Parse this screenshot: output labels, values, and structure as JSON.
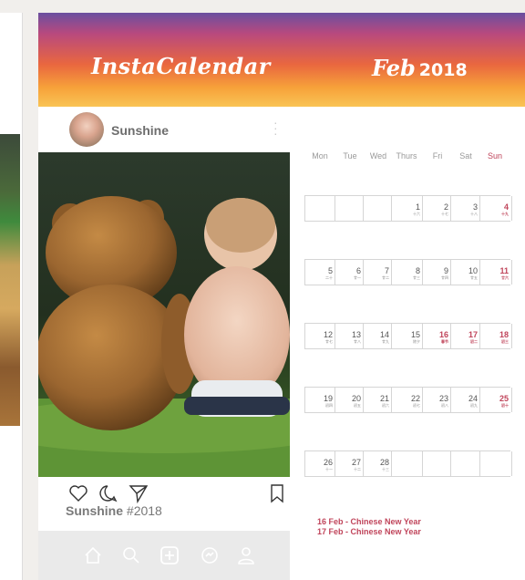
{
  "app_title": "InstaCalendar",
  "month": "Feb",
  "year": "2018",
  "post": {
    "username": "Sunshine",
    "caption_user": "Sunshine",
    "caption_tag": "#2018"
  },
  "icons": [
    "heart-icon",
    "comment-icon",
    "send-icon",
    "bookmark-icon",
    "home-icon",
    "search-icon",
    "add-icon",
    "activity-icon",
    "profile-icon",
    "more-icon"
  ],
  "calendar": {
    "weekdays": [
      "Mon",
      "Tue",
      "Wed",
      "Thurs",
      "Fri",
      "Sat",
      "Sun"
    ],
    "weeks": [
      [
        null,
        null,
        null,
        {
          "d": "1",
          "l": "十六"
        },
        {
          "d": "2",
          "l": "十七"
        },
        {
          "d": "3",
          "l": "十八"
        },
        {
          "d": "4",
          "l": "十九"
        }
      ],
      [
        {
          "d": "5",
          "l": "二十"
        },
        {
          "d": "6",
          "l": "廿一"
        },
        {
          "d": "7",
          "l": "廿二"
        },
        {
          "d": "8",
          "l": "廿三"
        },
        {
          "d": "9",
          "l": "廿四"
        },
        {
          "d": "10",
          "l": "廿五"
        },
        {
          "d": "11",
          "l": "廿六"
        }
      ],
      [
        {
          "d": "12",
          "l": "廿七"
        },
        {
          "d": "13",
          "l": "廿八"
        },
        {
          "d": "14",
          "l": "廿九"
        },
        {
          "d": "15",
          "l": "除夕"
        },
        {
          "d": "16",
          "l": "春节",
          "red": true
        },
        {
          "d": "17",
          "l": "初二",
          "red": true
        },
        {
          "d": "18",
          "l": "初三"
        }
      ],
      [
        {
          "d": "19",
          "l": "初四"
        },
        {
          "d": "20",
          "l": "初五"
        },
        {
          "d": "21",
          "l": "初六"
        },
        {
          "d": "22",
          "l": "初七"
        },
        {
          "d": "23",
          "l": "初八"
        },
        {
          "d": "24",
          "l": "初九"
        },
        {
          "d": "25",
          "l": "初十"
        }
      ],
      [
        {
          "d": "26",
          "l": "十一"
        },
        {
          "d": "27",
          "l": "十二"
        },
        {
          "d": "28",
          "l": "十三"
        },
        null,
        null,
        null,
        null
      ]
    ],
    "events": [
      "16 Feb - Chinese New Year",
      "17 Feb - Chinese New Year"
    ]
  },
  "colors": {
    "accent": "#c0455b",
    "header_top": "#6a4fa0",
    "header_mid": "#e9673f",
    "header_bottom": "#f9c455"
  }
}
